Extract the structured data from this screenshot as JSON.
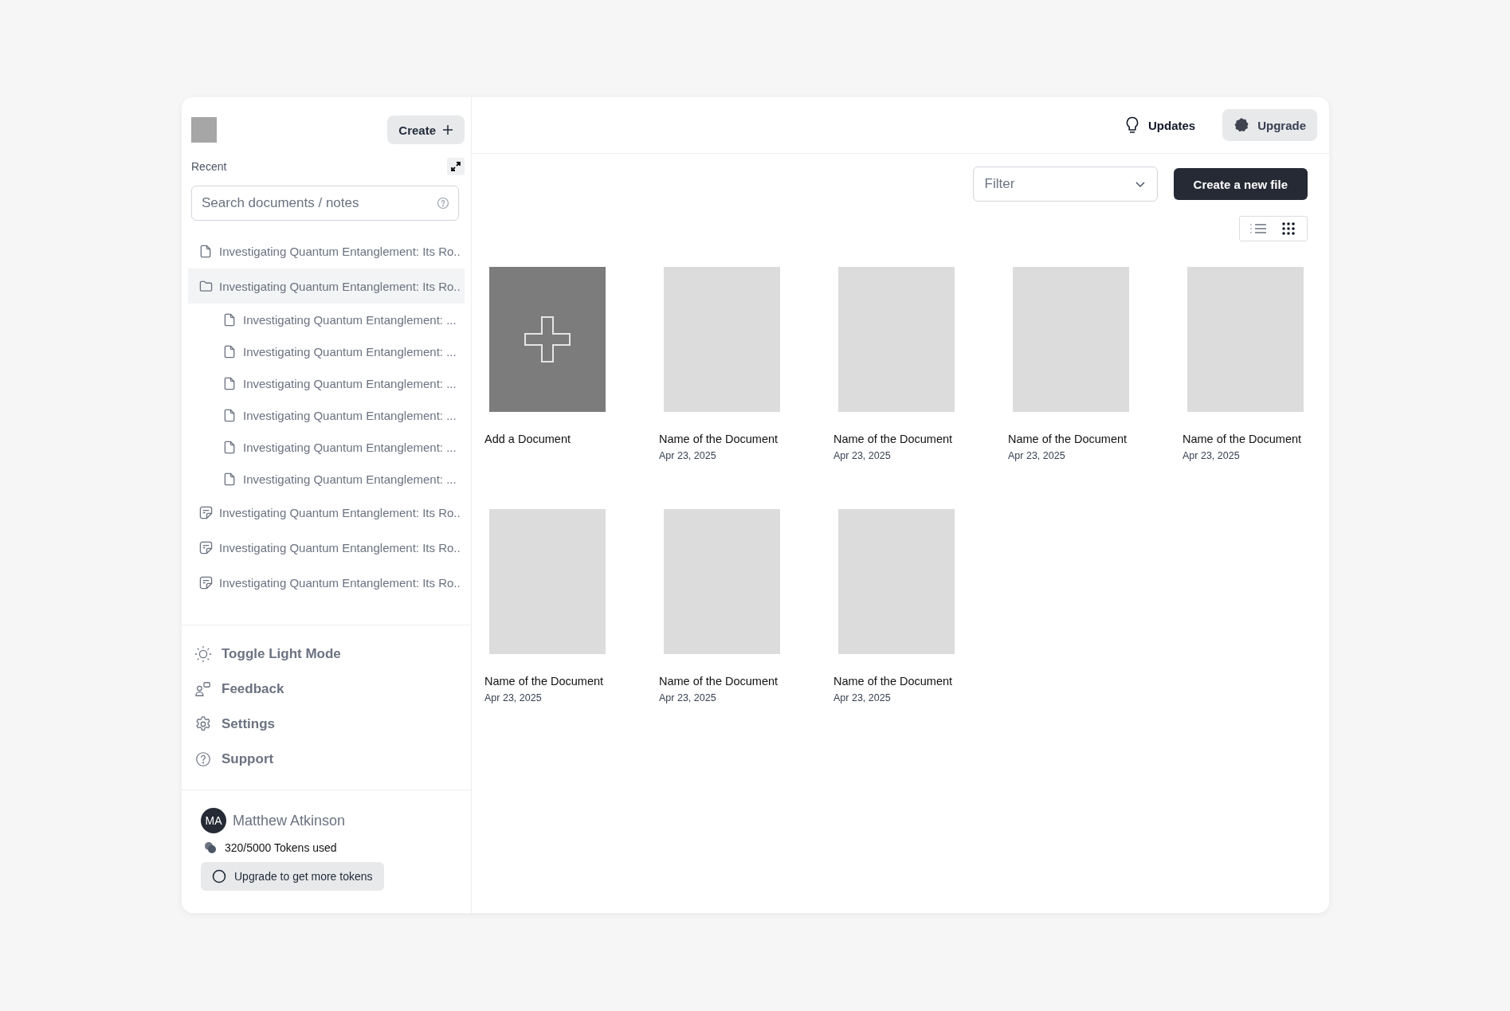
{
  "sidebar": {
    "create_button": "Create",
    "section_label": "Recent",
    "search": {
      "placeholder": "Search documents / notes"
    },
    "tree": [
      {
        "kind": "doc",
        "label": "Investigating Quantum Entanglement: Its Ro..",
        "selected": false
      },
      {
        "kind": "folder",
        "label": "Investigating Quantum Entanglement: Its Ro..",
        "selected": true,
        "children": [
          {
            "kind": "doc",
            "label": "Investigating Quantum Entanglement: ...",
            "selected": false
          },
          {
            "kind": "doc",
            "label": "Investigating Quantum Entanglement: ...",
            "selected": false
          },
          {
            "kind": "doc",
            "label": "Investigating Quantum Entanglement: ...",
            "selected": false
          },
          {
            "kind": "doc",
            "label": "Investigating Quantum Entanglement: ...",
            "selected": false
          },
          {
            "kind": "doc",
            "label": "Investigating Quantum Entanglement: ...",
            "selected": false
          },
          {
            "kind": "doc",
            "label": "Investigating Quantum Entanglement: ...",
            "selected": false
          }
        ]
      },
      {
        "kind": "note",
        "label": "Investigating Quantum Entanglement: Its Ro..",
        "selected": false
      },
      {
        "kind": "note",
        "label": "Investigating Quantum Entanglement: Its Ro..",
        "selected": false
      },
      {
        "kind": "note",
        "label": "Investigating Quantum Entanglement: Its Ro..",
        "selected": false
      }
    ],
    "menu": [
      {
        "kind": "theme",
        "label": "Toggle Light Mode"
      },
      {
        "kind": "feedback",
        "label": "Feedback"
      },
      {
        "kind": "settings",
        "label": "Settings"
      },
      {
        "kind": "support",
        "label": "Support"
      }
    ],
    "user": {
      "initials": "MA",
      "first_name": "Matthew",
      "last_name": "Atkinson",
      "tokens": "320/5000 Tokens used",
      "upgrade_button": "Upgrade to get more tokens"
    }
  },
  "header": {
    "updates": "Updates",
    "upgrade": "Upgrade"
  },
  "toolbar": {
    "filter": {
      "placeholder": "Filter"
    },
    "create_button": "Create a new file",
    "views": [
      {
        "kind": "list",
        "selected": false
      },
      {
        "kind": "grid",
        "selected": true
      }
    ]
  },
  "documents": [
    {
      "kind": "add",
      "title": "Add a Document"
    },
    {
      "kind": "document",
      "title": "Name of the Document",
      "date": "Apr 23, 2025"
    },
    {
      "kind": "document",
      "title": "Name of the Document",
      "date": "Apr 23, 2025"
    },
    {
      "kind": "document",
      "title": "Name of the Document",
      "date": "Apr 23, 2025"
    },
    {
      "kind": "document",
      "title": "Name of the Document",
      "date": "Apr 23, 2025"
    },
    {
      "kind": "document",
      "title": "Name of the Document",
      "date": "Apr 23, 2025"
    },
    {
      "kind": "document",
      "title": "Name of the Document",
      "date": "Apr 23, 2025"
    },
    {
      "kind": "document",
      "title": "Name of the Document",
      "date": "Apr 23, 2025"
    }
  ]
}
